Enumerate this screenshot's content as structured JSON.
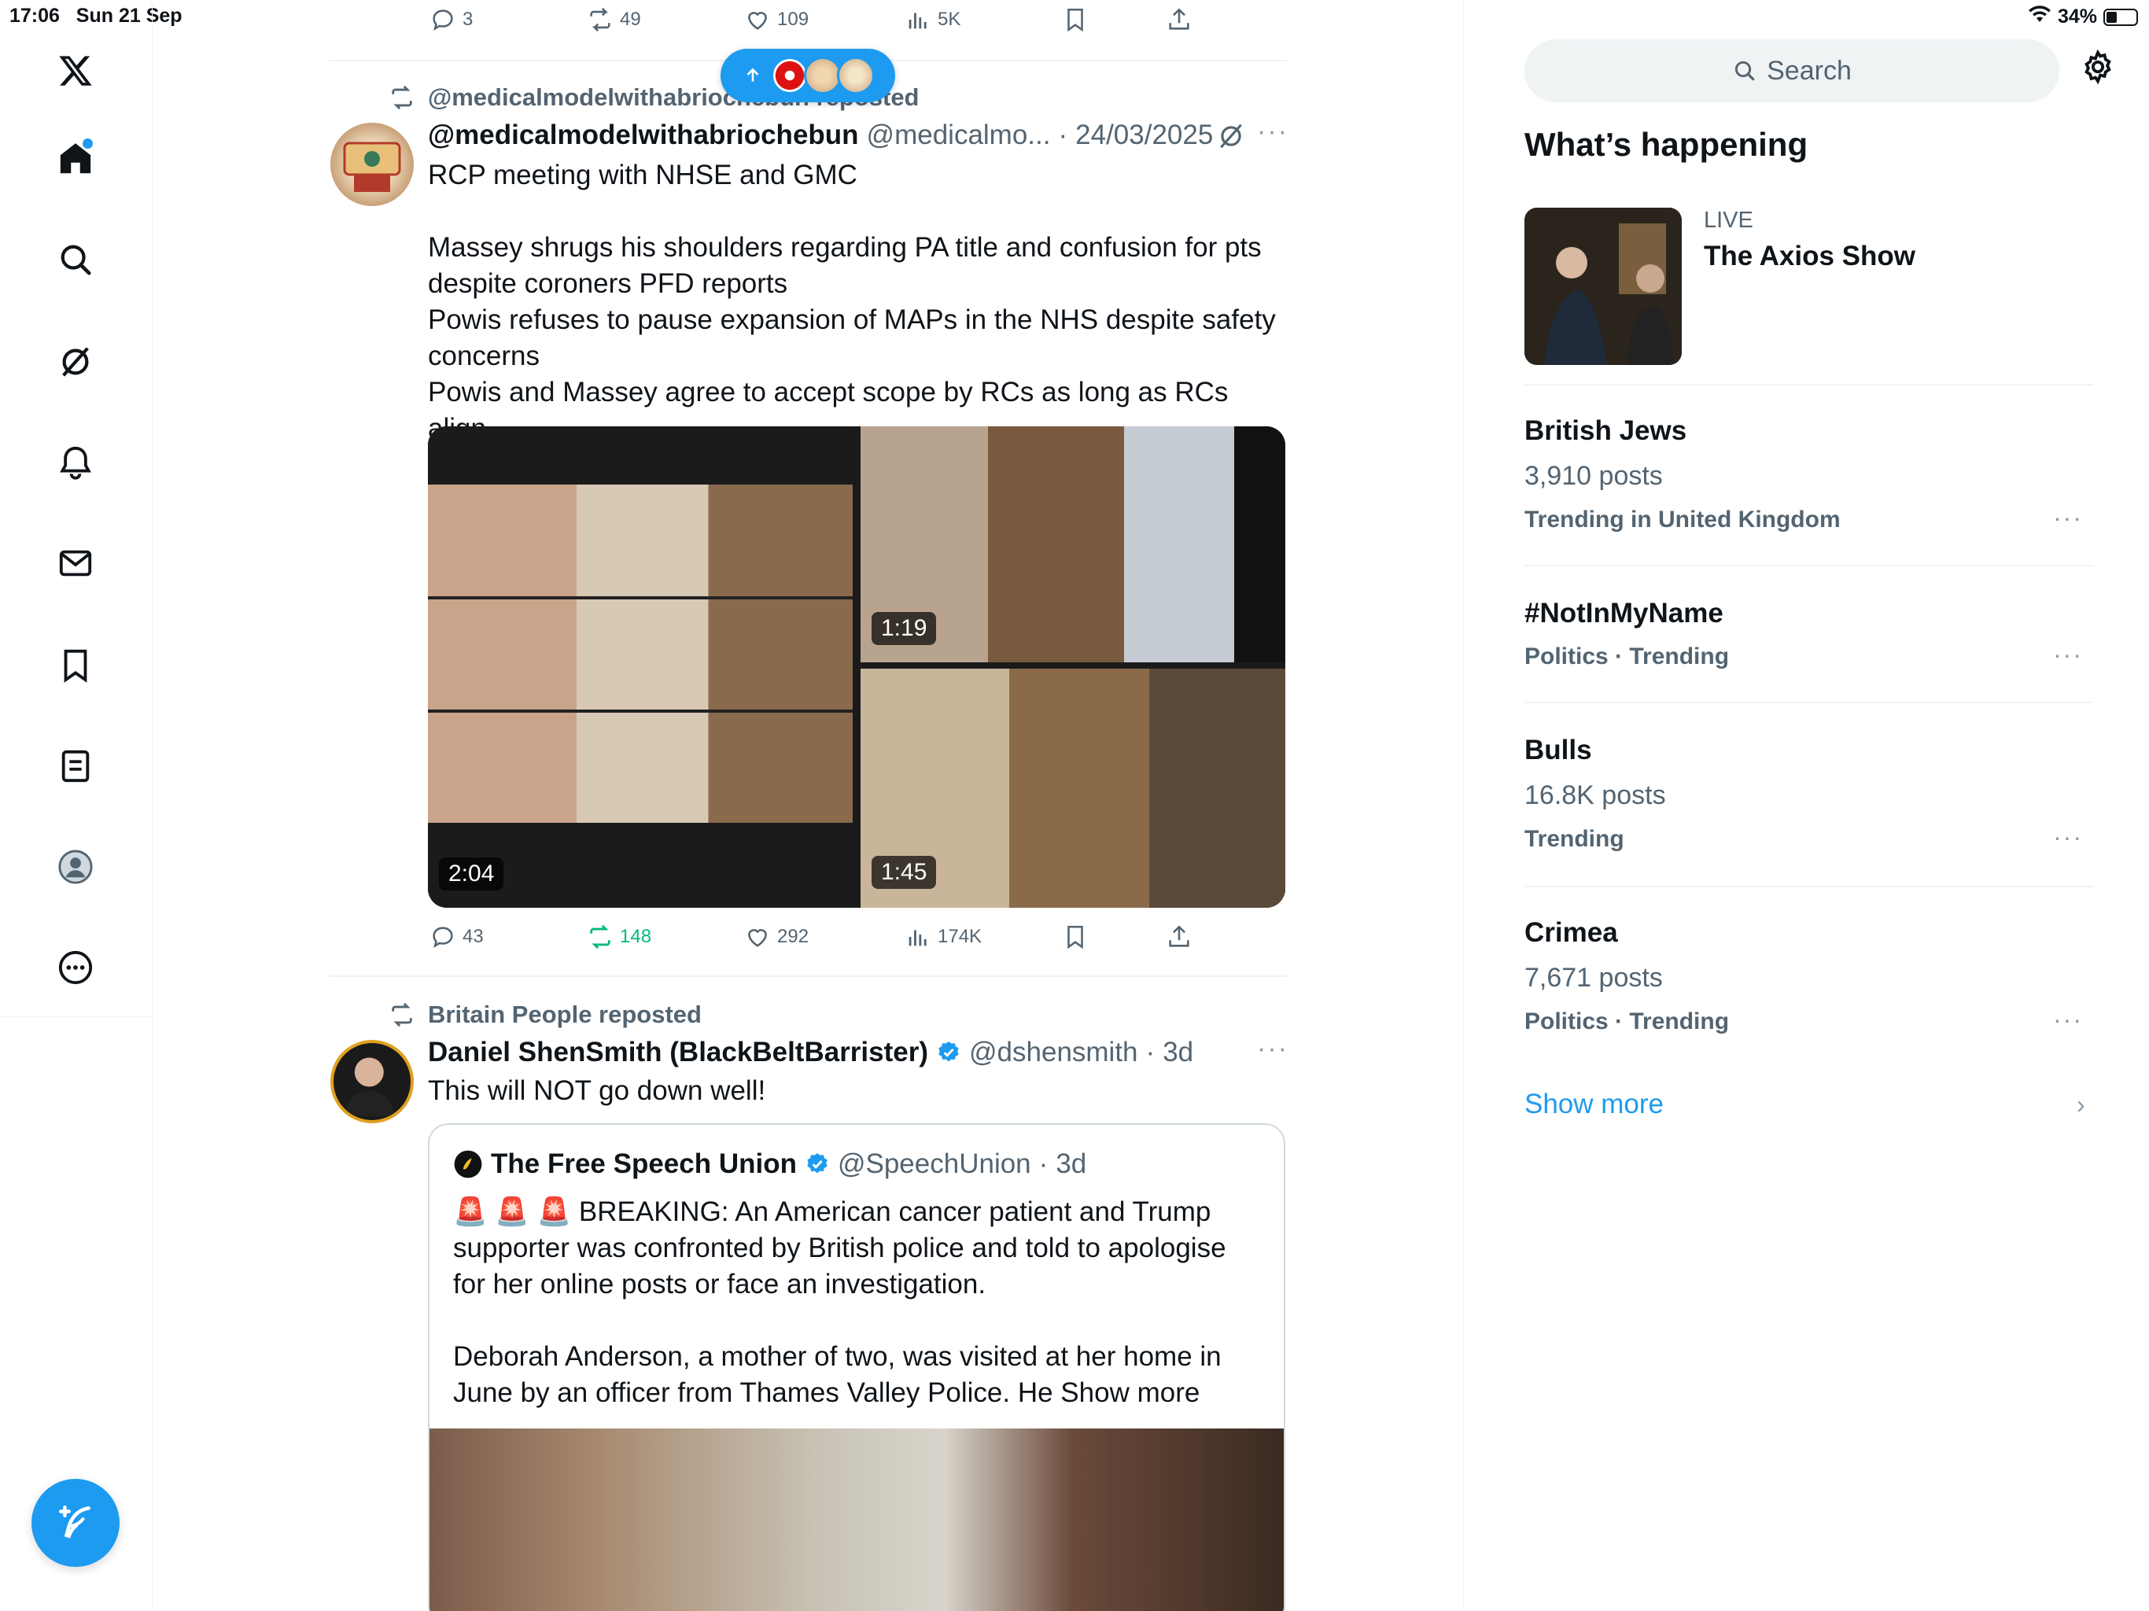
{
  "status_bar": {
    "time": "17:06",
    "date": "Sun 21 Sep",
    "battery": "34%"
  },
  "colors": {
    "accent": "#1d9bf0",
    "repost_green": "#00ba7c",
    "secondary_text": "#536471"
  },
  "nav": {
    "items": [
      "x-logo-icon",
      "home-icon",
      "search-icon",
      "grok-icon",
      "notifications-icon",
      "messages-icon",
      "bookmarks-icon",
      "lists-icon",
      "profile-icon",
      "more-icon"
    ],
    "compose_icon": "compose-feather-icon"
  },
  "top_actions": {
    "replies": "3",
    "reposts": "49",
    "likes": "109",
    "views": "5K"
  },
  "tweet1": {
    "repost_by": "@medicalmodelwithabriochebun reposted",
    "name": "@medicalmodelwithabriochebun",
    "handle": "@medicalmo...",
    "date": "24/03/2025",
    "text": "RCP meeting with NHSE and GMC\n\nMassey shrugs his shoulders regarding PA title and confusion for pts despite coroners PFD reports\nPowis refuses to pause expansion of MAPs in the NHS despite safety concerns\nPowis and Massey agree to accept scope by RCs as long as RCs align",
    "videos": [
      {
        "duration": "2:04"
      },
      {
        "duration": "1:19"
      },
      {
        "duration": "1:45"
      }
    ],
    "actions": {
      "replies": "43",
      "reposts": "148",
      "likes": "292",
      "views": "174K"
    }
  },
  "tweet2": {
    "repost_by": "Britain People reposted",
    "name": "Daniel ShenSmith (BlackBeltBarrister)",
    "handle": "@dshensmith",
    "time": "3d",
    "text": "This will NOT go down well!",
    "quote": {
      "name": "The Free Speech Union",
      "handle": "@SpeechUnion",
      "time": "3d",
      "text": "🚨 🚨 🚨 BREAKING: An American cancer patient and Trump supporter was confronted by British police and told to apologise for her online posts or face an investigation.\n\nDeborah Anderson, a mother of two, was visited at her home in June by an officer from Thames Valley Police. He Show more"
    }
  },
  "sidebar": {
    "search_placeholder": "Search",
    "section_title": "What’s happening",
    "live": {
      "label": "LIVE",
      "title": "The Axios Show"
    },
    "trends": [
      {
        "title": "British Jews",
        "posts": "3,910 posts",
        "meta": "Trending in United Kingdom"
      },
      {
        "title": "#NotInMyName",
        "posts": "",
        "meta": "Politics · Trending"
      },
      {
        "title": "Bulls",
        "posts": "16.8K posts",
        "meta": "Trending"
      },
      {
        "title": "Crimea",
        "posts": "7,671 posts",
        "meta": "Politics · Trending"
      }
    ],
    "show_more": "Show more"
  }
}
